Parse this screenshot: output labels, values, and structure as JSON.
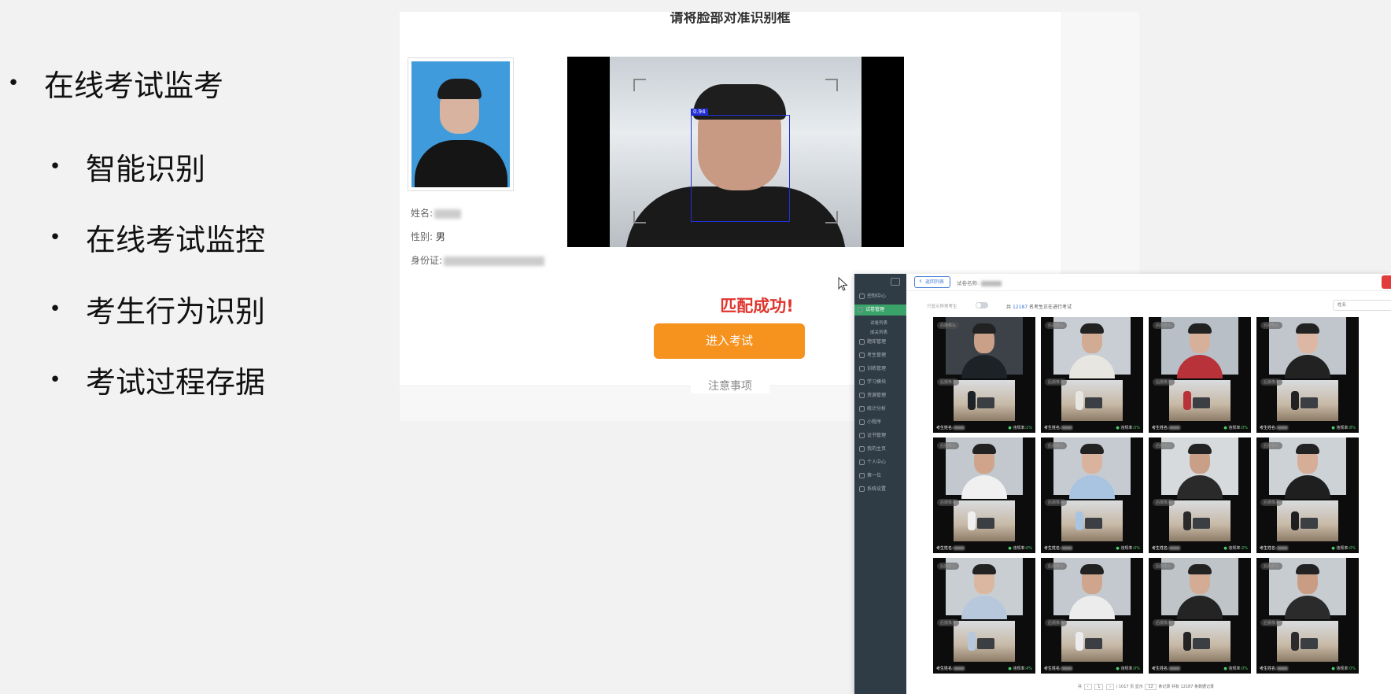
{
  "bullets": {
    "main": "在线考试监考",
    "items": [
      "智能识别",
      "在线考试监控",
      "考生行为识别",
      "考试过程存据"
    ]
  },
  "face_check": {
    "title": "请将脸部对准识别框",
    "name_label": "姓名:",
    "gender_label": "性别:",
    "gender_value": "男",
    "id_label": "身份证:",
    "score_tag": "0.94",
    "match_message": "匹配成功!",
    "enter_button": "进入考试",
    "notice": "注意事项"
  },
  "dashboard": {
    "back_button": "返回列表",
    "paper_label": "试卷名称:",
    "toggle_label": "只显示异常考生",
    "online_prefix": "共",
    "online_count": "12187",
    "online_suffix": "名考生正在进行考试",
    "search_placeholder": "姓名",
    "sidebar": [
      {
        "label": "控制中心",
        "active": false,
        "sub": false
      },
      {
        "label": "试卷管理",
        "active": true,
        "sub": false
      },
      {
        "label": "试卷列表",
        "active": false,
        "sub": true
      },
      {
        "label": "成关列表",
        "active": false,
        "sub": true
      },
      {
        "label": "题库管理",
        "active": false,
        "sub": false
      },
      {
        "label": "考生管理",
        "active": false,
        "sub": false
      },
      {
        "label": "训练管理",
        "active": false,
        "sub": false
      },
      {
        "label": "学习模块",
        "active": false,
        "sub": false
      },
      {
        "label": "资源管理",
        "active": false,
        "sub": false
      },
      {
        "label": "统计分析",
        "active": false,
        "sub": false
      },
      {
        "label": "小程序",
        "active": false,
        "sub": false
      },
      {
        "label": "证书管理",
        "active": false,
        "sub": false
      },
      {
        "label": "我的主页",
        "active": false,
        "sub": false
      },
      {
        "label": "个人中心",
        "active": false,
        "sub": false
      },
      {
        "label": "第一位",
        "active": false,
        "sub": false
      },
      {
        "label": "系统设置",
        "active": false,
        "sub": false
      }
    ],
    "camera_label_front": "后摄像头",
    "camera_label_back": "后摄像头",
    "name_label": "考生姓名:",
    "rate_label": "违规率:",
    "tiles": [
      {
        "rate": "1%",
        "scene": "#3d4249",
        "face": "#caa088",
        "shirt": "#1d2226"
      },
      {
        "rate": "5%",
        "scene": "#c8ced4",
        "face": "#d2ab95",
        "shirt": "#e8e6e1"
      },
      {
        "rate": "0%",
        "scene": "#b9bfc6",
        "face": "#d7b09b",
        "shirt": "#b8323a"
      },
      {
        "rate": "8%",
        "scene": "#c0c6cc",
        "face": "#dcb8a4",
        "shirt": "#222222"
      },
      {
        "rate": "0%",
        "scene": "#c2c8cd",
        "face": "#cfa48b",
        "shirt": "#f0f0f0"
      },
      {
        "rate": "0%",
        "scene": "#c5cbd1",
        "face": "#d9b39d",
        "shirt": "#a9c4e0"
      },
      {
        "rate": "2%",
        "scene": "#d6dadd",
        "face": "#c99f88",
        "shirt": "#2a2a2a"
      },
      {
        "rate": "0%",
        "scene": "#cdd2d6",
        "face": "#d6ae98",
        "shirt": "#1f1f1f"
      },
      {
        "rate": "4%",
        "scene": "#c9ced3",
        "face": "#dbb6a1",
        "shirt": "#b7c7dc"
      },
      {
        "rate": "0%",
        "scene": "#c3c9ce",
        "face": "#cfa58e",
        "shirt": "#ececec"
      },
      {
        "rate": "0%",
        "scene": "#bfc4c9",
        "face": "#d4ab94",
        "shirt": "#242424"
      },
      {
        "rate": "0%",
        "scene": "#c7ccd1",
        "face": "#c99c84",
        "shirt": "#2b2b2b"
      }
    ],
    "pager": {
      "total_prefix": "共",
      "page_current": "1",
      "page_text": "/ 1017 页 显示",
      "page_size": "12",
      "records_text": "条记录 共有 12187 条数据记录"
    }
  }
}
